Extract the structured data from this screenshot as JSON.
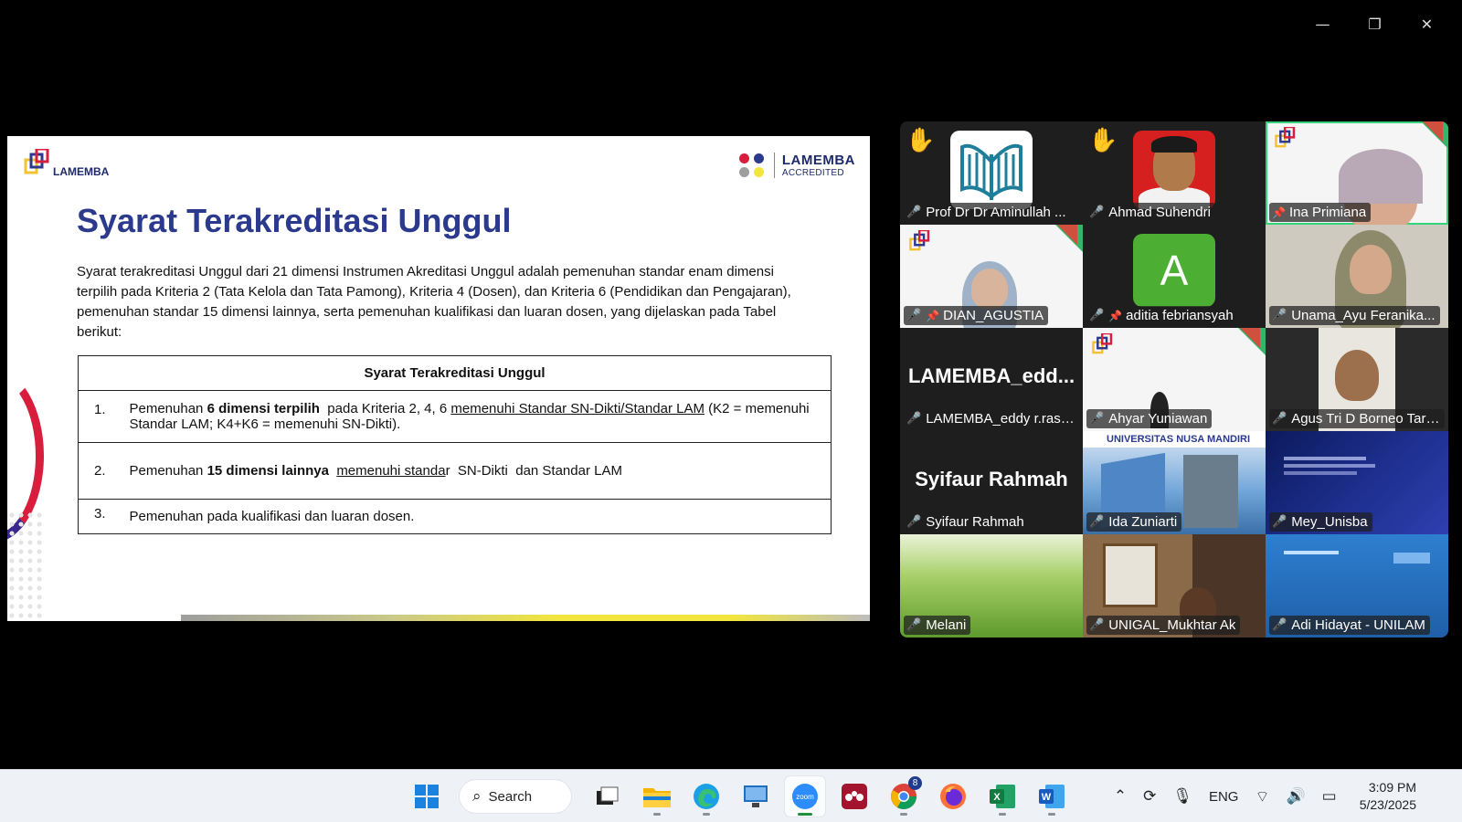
{
  "window_controls": {
    "minimize": "—",
    "restore": "❐",
    "close": "✕"
  },
  "slide": {
    "logo_left": "LAMEMBA",
    "logo_right_title": "LAMEMBA",
    "logo_right_sub": "ACCREDITED",
    "title": "Syarat Terakreditasi Unggul",
    "paragraph": "Syarat terakreditasi Unggul dari 21 dimensi Instrumen Akreditasi Unggul adalah pemenuhan standar enam dimensi terpilih pada Kriteria 2 (Tata Kelola dan Tata Pamong), Kriteria 4 (Dosen), dan Kriteria 6 (Pendidikan dan Pengajaran), pemenuhan standar 15 dimensi lainnya, serta pemenuhan kualifikasi dan luaran dosen, yang dijelaskan pada Tabel berikut:",
    "table_header": "Syarat Terakreditasi Unggul",
    "rows": [
      {
        "num": "1.",
        "pre": "Pemenuhan ",
        "bold": "6 dimensi terpilih",
        "mid": "  pada Kriteria 2, 4, 6 ",
        "underline": "memenuhi Standar SN-Dikti/Standar LAM",
        "post": " (K2 = memenuhi Standar LAM; K4+K6 = memenuhi SN-Dikti)."
      },
      {
        "num": "2.",
        "pre": "Pemenuhan ",
        "bold": "15 dimensi lainnya",
        "mid": "  ",
        "underline": "memenuhi standa",
        "post": "r  SN-Dikti  dan Standar LAM"
      },
      {
        "num": "3.",
        "text": "Pemenuhan pada kualifikasi dan luaran dosen."
      }
    ],
    "colors": {
      "title": "#2b3a8c",
      "brand_red": "#d81e3c",
      "brand_blue": "#1d2a6b",
      "accent_yellow": "#f2e53d"
    }
  },
  "participants": [
    {
      "name": "Prof Dr Dr Aminullah ...",
      "hand": "✋",
      "mic": "muted",
      "avatar": "tree-logo"
    },
    {
      "name": "Ahmad Suhendri",
      "hand": "✋",
      "mic": "muted",
      "avatar": "photo"
    },
    {
      "name": "Ina Primiana",
      "pinned": true,
      "active": true,
      "avatar": "video"
    },
    {
      "name": "DIAN_AGUSTIA",
      "mic": "muted",
      "pinned": true,
      "avatar": "video"
    },
    {
      "name": "aditia febriansyah",
      "mic": "muted",
      "pinned": true,
      "avatar_letter": "A"
    },
    {
      "name": "Unama_Ayu Feranika...",
      "mic": "muted",
      "avatar": "video"
    },
    {
      "name": "LAMEMBA_eddy r.rasy...",
      "big": "LAMEMBA_edd...",
      "mic": "muted"
    },
    {
      "name": "Ahyar Yuniawan",
      "mic": "muted",
      "avatar": "video"
    },
    {
      "name": "Agus Tri D Borneo Tara...",
      "mic": "muted",
      "avatar": "video"
    },
    {
      "name": "Syifaur Rahmah",
      "big": "Syifaur Rahmah",
      "mic": "muted"
    },
    {
      "name": "Ida Zuniarti",
      "mic": "muted",
      "banner": "UNIVERSITAS NUSA MANDIRI",
      "avatar": "video"
    },
    {
      "name": "Mey_Unisba",
      "mic": "muted",
      "avatar": "video"
    },
    {
      "name": "Melani",
      "mic": "muted",
      "avatar": "video"
    },
    {
      "name": "UNIGAL_Mukhtar Ak",
      "mic": "muted",
      "avatar": "video"
    },
    {
      "name": "Adi Hidayat - UNILAM",
      "mic": "muted",
      "avatar": "video"
    }
  ],
  "taskbar": {
    "search_label": "Search",
    "apps": [
      "windows-start",
      "search",
      "task-view",
      "file-explorer",
      "edge",
      "remote-desktop",
      "zoom",
      "mendeley",
      "chrome",
      "firefox",
      "excel",
      "word"
    ],
    "zoom_label": "zoom",
    "chrome_badge": "8",
    "language": "ENG",
    "time": "3:09 PM",
    "date": "5/23/2025"
  }
}
